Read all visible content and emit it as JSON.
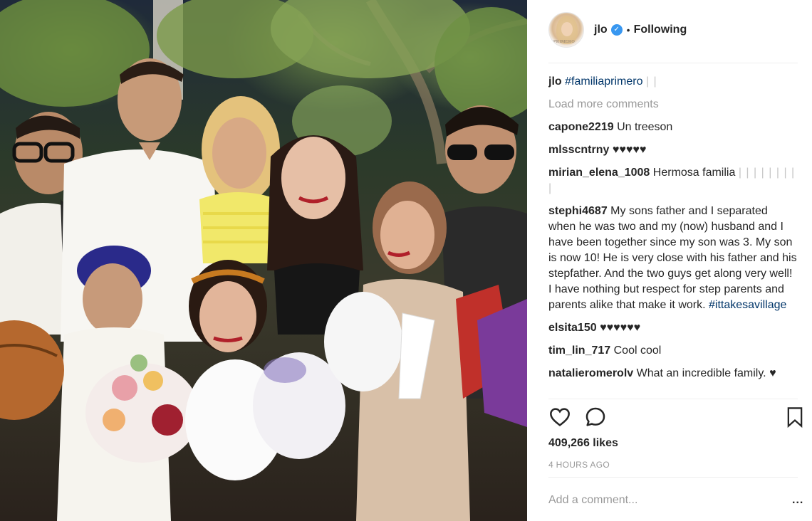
{
  "post": {
    "photo_alt": "Group photo of family at night holding bouquets",
    "author": {
      "username": "jlo",
      "verified": true,
      "follow_status": "Following",
      "avatar_caption": "PRIMERO"
    },
    "caption": {
      "username": "jlo",
      "text": "#familiaprimero",
      "suffix": "| |"
    },
    "load_more": "Load more comments",
    "comments": [
      {
        "username": "capone2219",
        "text": "Un treeson"
      },
      {
        "username": "mlsscntrny",
        "text": "♥♥♥♥♥"
      },
      {
        "username": "mirian_elena_1008",
        "text": "Hermosa familia",
        "suffix": "| | | | | | | | |"
      },
      {
        "username": "stephi4687",
        "text": "My sons father and I separated when he was two and my (now) husband and I have been together since my son was 3. My son is now 10! He is very close with his father and his stepfather. And the two guys get along very well! I have nothing but respect for step parents and parents alike that make it work.",
        "hashtag": "#ittakesavillage"
      },
      {
        "username": "elsita150",
        "text": "♥♥♥♥♥♥"
      },
      {
        "username": "tim_lin_717",
        "text": "Cool cool"
      },
      {
        "username": "natalieromerolv",
        "text": "What an incredible family.",
        "suffix": "♥"
      }
    ],
    "likes": "409,266 likes",
    "timestamp": "4 HOURS AGO",
    "add_comment_placeholder": "Add a comment...",
    "more_options": "..."
  },
  "colors": {
    "link": "#003569",
    "verified": "#3897f0",
    "muted": "#999999",
    "text": "#262626"
  },
  "icons": [
    "verified-badge-icon",
    "heart-icon",
    "comment-icon",
    "bookmark-icon",
    "more-options-icon"
  ]
}
